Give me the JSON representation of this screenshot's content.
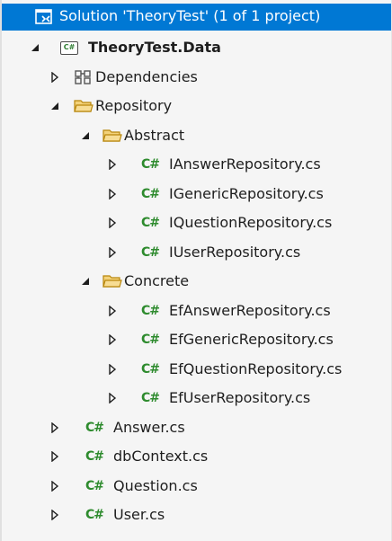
{
  "solution": {
    "label": "Solution 'TheoryTest' (1 of 1 project)",
    "icon": "solution-icon"
  },
  "project": {
    "label": "TheoryTest.Data",
    "icon": "csharp-project-icon",
    "expanded": true
  },
  "nodes": {
    "dependencies": "Dependencies",
    "repository": "Repository",
    "abstract": "Abstract",
    "abstract_files": [
      "IAnswerRepository.cs",
      "IGenericRepository.cs",
      "IQuestionRepository.cs",
      "IUserRepository.cs"
    ],
    "concrete": "Concrete",
    "concrete_files": [
      "EfAnswerRepository.cs",
      "EfGenericRepository.cs",
      "EfQuestionRepository.cs",
      "EfUserRepository.cs"
    ],
    "root_files": [
      "Answer.cs",
      "dbContext.cs",
      "Question.cs",
      "User.cs"
    ]
  },
  "icons": {
    "cs_glyph": "C#",
    "csproj_glyph": "C#"
  },
  "colors": {
    "selection": "#0078d4",
    "csharp": "#2e8b2e",
    "folder_fill": "#f3d27a",
    "folder_stroke": "#b8860b"
  }
}
